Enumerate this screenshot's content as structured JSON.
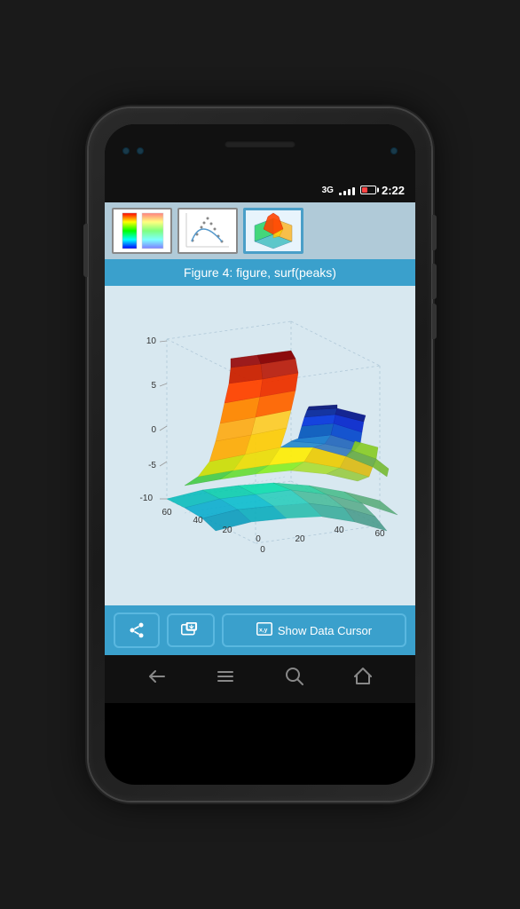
{
  "status_bar": {
    "network": "3G",
    "time": "2:22",
    "signal_bars": [
      3,
      5,
      7,
      9,
      11
    ],
    "battery_level": "low"
  },
  "thumbnails": [
    {
      "id": 1,
      "label": "thumb-colormap",
      "active": false
    },
    {
      "id": 2,
      "label": "thumb-scatter",
      "active": false
    },
    {
      "id": 3,
      "label": "thumb-3d",
      "active": true
    }
  ],
  "figure_title": "Figure 4: figure, surf(peaks)",
  "chart": {
    "type": "surf_peaks",
    "y_axis_labels": [
      "10",
      "5",
      "0",
      "-5",
      "-10"
    ],
    "x_axis_labels": [
      "0",
      "20",
      "40",
      "60"
    ],
    "z_axis_labels": [
      "0",
      "20",
      "40",
      "60"
    ]
  },
  "toolbar": {
    "share_label": "",
    "screenshot_label": "",
    "data_cursor_label": "Show Data Cursor"
  }
}
